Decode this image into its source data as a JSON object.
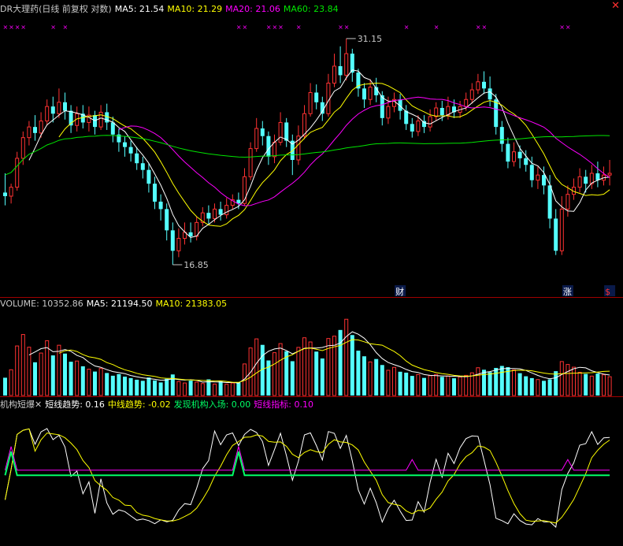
{
  "colors": {
    "bg": "#000000",
    "up": "#ff3232",
    "down": "#54ffff",
    "ma5": "#ffffff",
    "ma10": "#ffff00",
    "ma20": "#ff00ff",
    "ma60": "#00e600",
    "label": "#c8c8c8",
    "ind_green": "#00ff66",
    "ind_magenta": "#ff00ff"
  },
  "close_icon": "close-icon",
  "price_header": {
    "name": "DR大理药(日线 前复权 对数)",
    "ma5": "MA5: 21.54",
    "ma10": "MA10: 21.29",
    "ma20": "MA20: 21.06",
    "ma60": "MA60: 23.84"
  },
  "volume_header": {
    "vol": "VOLUME: 10352.86",
    "ma5": "MA5: 21194.50",
    "ma10": "MA10: 21383.05"
  },
  "indicator_header": {
    "name": "机构短爆",
    "icon": "x-icon",
    "short": "短线趋势: 0.16",
    "mid": "中线趋势: -0.02",
    "inst": "发现机构入场: 0.00",
    "short_idx": "短线指标: 0.10"
  },
  "markers": {
    "high": "31.15",
    "low": "16.85",
    "event_cai": "财",
    "event_zhang": "涨",
    "event_s": "$"
  },
  "chart_data": [
    {
      "type": "candlestick",
      "title": "DR大理药(日线 前复权 对数)",
      "ylim": [
        15.6,
        33.0
      ],
      "y_scale": "log",
      "high_label": 31.15,
      "low_label": 16.85,
      "series": [
        {
          "name": "MA5",
          "last": 21.54
        },
        {
          "name": "MA10",
          "last": 21.29
        },
        {
          "name": "MA20",
          "last": 21.06
        },
        {
          "name": "MA60",
          "last": 23.84
        }
      ],
      "candles": [
        [
          20.5,
          20.3,
          21.6,
          19.8
        ],
        [
          20.3,
          20.8,
          21.0,
          19.9
        ],
        [
          20.8,
          22.5,
          22.9,
          20.6
        ],
        [
          22.5,
          23.8,
          24.2,
          22.1
        ],
        [
          23.8,
          24.5,
          24.9,
          23.3
        ],
        [
          24.5,
          24.1,
          25.3,
          23.6
        ],
        [
          24.1,
          24.9,
          25.5,
          23.8
        ],
        [
          24.9,
          25.9,
          26.4,
          24.6
        ],
        [
          25.9,
          25.4,
          26.6,
          24.8
        ],
        [
          25.4,
          26.2,
          27.2,
          25.1
        ],
        [
          26.2,
          25.6,
          26.9,
          25.0
        ],
        [
          25.6,
          24.6,
          26.0,
          24.1
        ],
        [
          24.6,
          25.4,
          25.9,
          24.2
        ],
        [
          25.4,
          24.8,
          26.0,
          24.4
        ],
        [
          24.8,
          25.3,
          25.9,
          24.2
        ],
        [
          25.3,
          24.5,
          25.6,
          24.0
        ],
        [
          24.5,
          25.5,
          26.0,
          24.3
        ],
        [
          25.5,
          24.8,
          26.1,
          24.3
        ],
        [
          24.8,
          24.0,
          25.2,
          23.5
        ],
        [
          24.0,
          23.5,
          24.4,
          22.9
        ],
        [
          23.5,
          23.2,
          23.9,
          22.6
        ],
        [
          23.2,
          22.8,
          23.6,
          22.3
        ],
        [
          22.8,
          22.2,
          23.2,
          21.8
        ],
        [
          22.2,
          21.8,
          22.6,
          21.3
        ],
        [
          21.8,
          21.0,
          22.2,
          20.5
        ],
        [
          21.0,
          20.0,
          21.4,
          19.6
        ],
        [
          20.0,
          19.6,
          20.4,
          19.0
        ],
        [
          19.6,
          18.5,
          19.9,
          18.0
        ],
        [
          18.5,
          17.5,
          18.9,
          16.85
        ],
        [
          17.5,
          18.1,
          18.6,
          17.2
        ],
        [
          18.1,
          18.4,
          18.9,
          17.8
        ],
        [
          18.4,
          18.2,
          18.9,
          17.9
        ],
        [
          18.2,
          18.9,
          19.2,
          18.0
        ],
        [
          18.9,
          19.4,
          19.7,
          18.7
        ],
        [
          19.4,
          19.1,
          19.8,
          18.8
        ],
        [
          19.1,
          19.6,
          19.9,
          18.9
        ],
        [
          19.6,
          19.3,
          20.0,
          19.0
        ],
        [
          19.3,
          19.8,
          20.2,
          19.1
        ],
        [
          19.8,
          20.1,
          20.4,
          19.6
        ],
        [
          20.1,
          19.9,
          20.5,
          19.6
        ],
        [
          19.9,
          21.4,
          21.9,
          19.8
        ],
        [
          21.4,
          23.1,
          23.5,
          21.2
        ],
        [
          23.1,
          24.4,
          25.1,
          22.9
        ],
        [
          24.4,
          23.9,
          24.9,
          23.3
        ],
        [
          23.9,
          22.6,
          24.2,
          22.1
        ],
        [
          22.6,
          23.5,
          24.0,
          22.2
        ],
        [
          23.5,
          24.8,
          25.5,
          23.3
        ],
        [
          24.8,
          23.6,
          25.1,
          23.2
        ],
        [
          23.6,
          22.4,
          24.0,
          21.5
        ],
        [
          22.4,
          23.9,
          24.6,
          22.1
        ],
        [
          23.9,
          25.4,
          26.0,
          23.7
        ],
        [
          25.4,
          26.9,
          27.6,
          25.2
        ],
        [
          26.9,
          26.2,
          27.5,
          25.7
        ],
        [
          26.2,
          25.4,
          26.6,
          24.9
        ],
        [
          25.4,
          27.6,
          28.3,
          25.2
        ],
        [
          27.6,
          28.9,
          29.9,
          27.3
        ],
        [
          28.9,
          28.2,
          30.5,
          27.6
        ],
        [
          28.2,
          29.9,
          31.15,
          27.8
        ],
        [
          29.9,
          28.4,
          30.3,
          27.7
        ],
        [
          28.4,
          27.2,
          28.7,
          26.6
        ],
        [
          27.2,
          26.4,
          27.6,
          25.8
        ],
        [
          26.4,
          27.3,
          27.9,
          26.0
        ],
        [
          27.3,
          26.7,
          28.0,
          26.2
        ],
        [
          26.7,
          25.1,
          27.0,
          24.6
        ],
        [
          25.1,
          25.9,
          26.6,
          24.7
        ],
        [
          25.9,
          26.4,
          26.9,
          25.5
        ],
        [
          26.4,
          25.6,
          26.8,
          25.0
        ],
        [
          25.6,
          24.7,
          26.0,
          24.3
        ],
        [
          24.7,
          24.2,
          25.1,
          23.8
        ],
        [
          24.2,
          24.9,
          25.3,
          23.9
        ],
        [
          24.9,
          24.5,
          25.3,
          24.1
        ],
        [
          24.5,
          25.2,
          25.7,
          24.2
        ],
        [
          25.2,
          25.8,
          26.2,
          24.9
        ],
        [
          25.8,
          25.3,
          26.3,
          24.9
        ],
        [
          25.3,
          25.9,
          26.6,
          25.0
        ],
        [
          25.9,
          25.5,
          26.4,
          25.1
        ],
        [
          25.5,
          25.9,
          26.3,
          25.1
        ],
        [
          25.9,
          26.4,
          26.9,
          25.6
        ],
        [
          26.4,
          27.1,
          27.6,
          26.1
        ],
        [
          27.1,
          27.7,
          28.3,
          26.8
        ],
        [
          27.7,
          27.2,
          28.5,
          26.8
        ],
        [
          27.2,
          26.4,
          28.1,
          25.9
        ],
        [
          26.4,
          24.5,
          26.8,
          24.0
        ],
        [
          24.5,
          23.4,
          24.9,
          22.9
        ],
        [
          23.4,
          22.3,
          23.8,
          21.9
        ],
        [
          22.3,
          22.9,
          23.5,
          22.0
        ],
        [
          22.9,
          22.5,
          23.3,
          21.9
        ],
        [
          22.5,
          22.1,
          23.0,
          21.7
        ],
        [
          22.1,
          21.2,
          22.6,
          20.8
        ],
        [
          21.2,
          21.5,
          22.0,
          20.7
        ],
        [
          21.5,
          20.9,
          22.0,
          20.4
        ],
        [
          20.9,
          19.1,
          21.5,
          18.6
        ],
        [
          19.1,
          17.5,
          19.6,
          17.3
        ],
        [
          17.5,
          19.6,
          20.3,
          17.3
        ],
        [
          19.6,
          20.4,
          20.9,
          19.2
        ],
        [
          20.4,
          20.8,
          21.3,
          20.1
        ],
        [
          20.8,
          21.4,
          21.9,
          20.5
        ],
        [
          21.4,
          21.0,
          21.8,
          20.5
        ],
        [
          21.0,
          21.6,
          22.1,
          20.7
        ],
        [
          21.6,
          21.2,
          22.3,
          20.8
        ],
        [
          21.2,
          21.5,
          22.0,
          20.9
        ],
        [
          21.5,
          21.6,
          22.4,
          20.9
        ]
      ]
    },
    {
      "type": "bar",
      "title": "VOLUME",
      "ylim": [
        0,
        46000
      ],
      "series": [
        {
          "name": "VOLUME",
          "last": 10352.86
        },
        {
          "name": "MA5",
          "last": 21194.5
        },
        {
          "name": "MA10",
          "last": 21383.05
        }
      ],
      "values": [
        9800,
        14200,
        27300,
        33600,
        26600,
        18300,
        23400,
        30200,
        22100,
        27700,
        23100,
        18600,
        19000,
        16100,
        14500,
        13200,
        14900,
        12400,
        10900,
        11800,
        10400,
        9600,
        8700,
        8100,
        9900,
        8300,
        7200,
        9200,
        11600,
        7700,
        6900,
        8200,
        7400,
        6600,
        8900,
        6300,
        7800,
        6200,
        6900,
        7100,
        17400,
        26200,
        31200,
        27900,
        19300,
        23600,
        28600,
        24400,
        18900,
        26500,
        31800,
        29500,
        24200,
        20400,
        31400,
        32700,
        36100,
        42000,
        33300,
        24700,
        21600,
        18500,
        20100,
        16800,
        13900,
        15500,
        13100,
        12600,
        10800,
        11600,
        9700,
        10900,
        11600,
        10300,
        10800,
        9500,
        10200,
        11100,
        12500,
        15300,
        14200,
        12900,
        15200,
        16300,
        15600,
        14100,
        12300,
        10600,
        9600,
        8800,
        8100,
        8900,
        13400,
        18700,
        17100,
        15600,
        12800,
        11900,
        10700,
        12100,
        11400,
        10352.86
      ]
    },
    {
      "type": "line",
      "title": "机构短爆",
      "ylim": [
        -1.3,
        1.25
      ],
      "series": [
        {
          "name": "短线趋势",
          "last": 0.16
        },
        {
          "name": "中线趋势",
          "last": -0.02
        },
        {
          "name": "发现机构入场",
          "last": 0.0
        },
        {
          "name": "短线指标",
          "last": 0.1
        }
      ]
    }
  ]
}
